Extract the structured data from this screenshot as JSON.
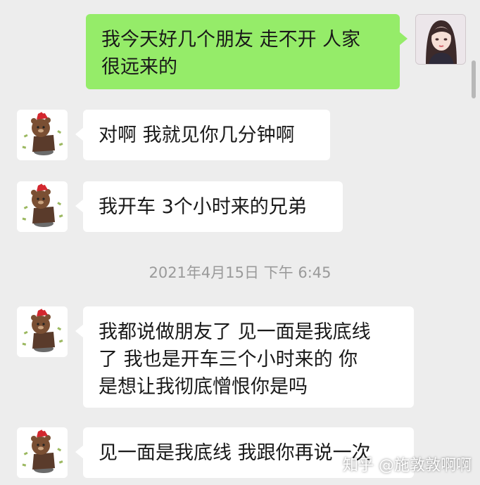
{
  "messages": [
    {
      "sender": "self",
      "text": "我今天好几个朋友 走不开 人家\n很远来的"
    },
    {
      "sender": "other",
      "text": "对啊 我就见你几分钟啊"
    },
    {
      "sender": "other",
      "text": "我开车 3个小时来的兄弟"
    },
    {
      "sender": "other",
      "text": "我都说做朋友了 见一面是我底线\n了 我也是开车三个小时来的 你\n是想让我彻底憎恨你是吗"
    },
    {
      "sender": "other",
      "text": "见一面是我底线 我跟你再说一次"
    }
  ],
  "timestamp": "2021年4月15日 下午 6:45",
  "watermark": "知乎 @施敦敦啊啊",
  "colors": {
    "background": "#ededed",
    "outgoing_bubble": "#95ec69",
    "incoming_bubble": "#ffffff",
    "timestamp": "#9a9a9a"
  },
  "icons": {
    "self_avatar": "girl-avatar-icon",
    "other_avatar": "bear-avatar-icon"
  }
}
